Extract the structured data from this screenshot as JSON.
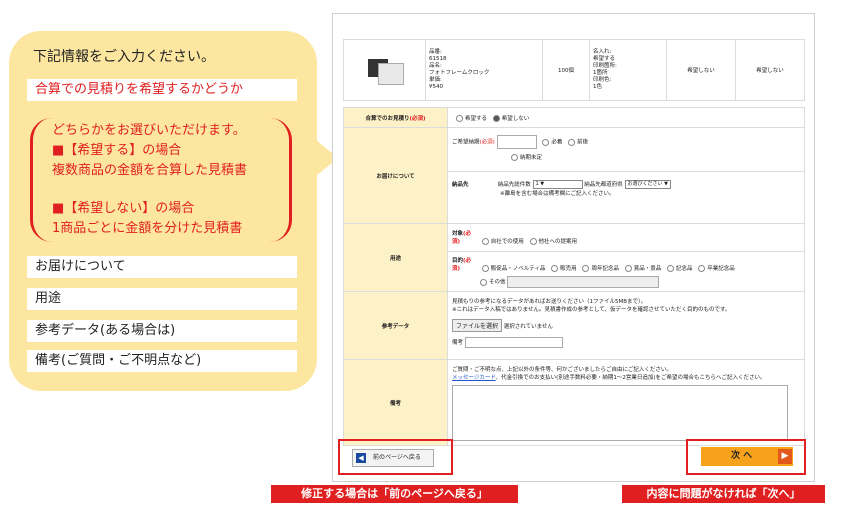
{
  "callout": {
    "title": "下記情報をご入力ください。",
    "row_estimate": "合算での見積りを希望するかどうか",
    "note_lines": [
      "どちらかをお選びいただけます。",
      "■【希望する】の場合",
      "複数商品の金額を合算した見積書",
      "",
      "■【希望しない】の場合",
      "1商品ごとに金額を分けた見積書"
    ],
    "row_delivery": "お届けについて",
    "row_purpose": "用途",
    "row_reference": "参考データ(ある場合は)",
    "row_remarks": "備考(ご質問・ご不明点など)"
  },
  "product": {
    "info": [
      "品番:",
      "61518",
      "品名:",
      "フォトフレームクロック",
      "単価:",
      "¥540"
    ],
    "quantity": "100個",
    "print": [
      "名入れ:",
      "希望する",
      "印刷箇所:",
      "1箇所",
      "印刷色:",
      "1色"
    ],
    "col4": "希望しない",
    "col5": "希望しない"
  },
  "form": {
    "combined_label": "合算でのお見積り",
    "required": "(必須)",
    "combined_yes": "希望する",
    "combined_no": "希望しない",
    "delivery_label": "お届けについて",
    "desired_date_label": "ご希望納期",
    "option_required": "必着",
    "option_around": "前後",
    "option_undecided": "納期未定",
    "destination_label": "納品先",
    "dest_count_label": "納品先総件数",
    "dest_count_value": "1",
    "dest_pref_label": "納品先都道府県",
    "dest_pref_value": "お選びください",
    "dest_note": "※離島を含む場合は備考欄にご記入ください。",
    "purpose_label": "用途",
    "target_label": "対象",
    "target_self": "自社での使用",
    "target_other": "他社への提案用",
    "aim_label": "目的",
    "aim_options": [
      "販促品・ノベルティ品",
      "販売用",
      "周年記念品",
      "賞品・景品",
      "記念品",
      "卒業記念品"
    ],
    "aim_other": "その他",
    "reference_label": "参考データ",
    "reference_note1": "見積もりの参考になるデータがあればお送りください（1ファイル5MBまで）。",
    "reference_note2": "※これはデータ入稿ではありません。見積書作成の参考として、仮データを確認させていただく目的のものです。",
    "file_button": "ファイルを選択",
    "file_status": "選択されていません",
    "memo_label": "備考",
    "remarks_label": "備考",
    "remarks_note1": "ご質問・ご不明な点、上記以外の条件等、何かございましたらご自由にご記入ください。",
    "remarks_link": "メッセージカード",
    "remarks_note2": "、代金引換でのお支払い(別途手数料必要・納期1～2営業日追加)をご希望の場合もこちらへご記入ください。"
  },
  "nav": {
    "back_label": "前のページへ戻る",
    "next_label": "次 へ",
    "back_caption": "修正する場合は「前のページへ戻る」",
    "next_caption": "内容に問題がなければ「次へ」"
  },
  "colors": {
    "highlight": "#e02020",
    "callout_bg": "#fde7a0",
    "label_bg": "#fdf1c8",
    "next_button": "#f7a21b"
  }
}
